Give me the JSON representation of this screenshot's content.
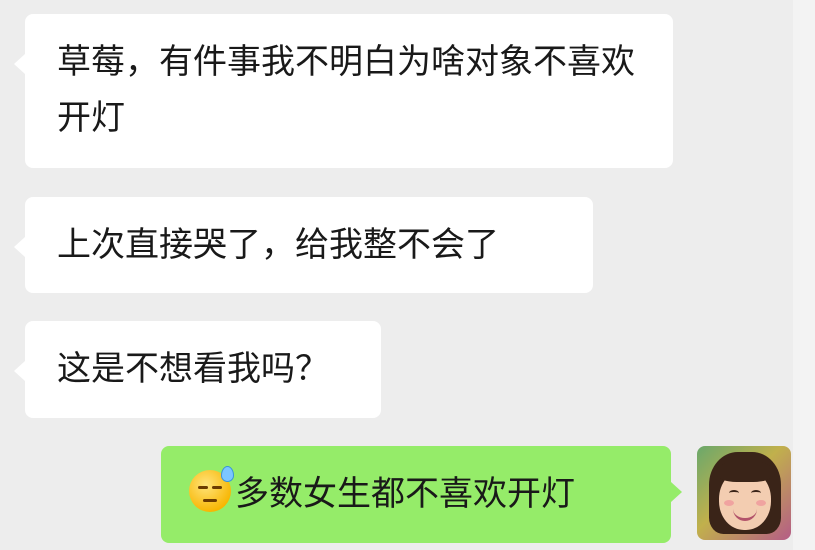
{
  "messages": [
    {
      "direction": "incoming",
      "text": "草莓，有件事我不明白为啥对象不喜欢开灯"
    },
    {
      "direction": "incoming",
      "text": "上次直接哭了，给我整不会了"
    },
    {
      "direction": "incoming",
      "text": "这是不想看我吗？"
    },
    {
      "direction": "outgoing",
      "emoji": "downcast-face-with-sweat-icon",
      "text": "多数女生都不喜欢开灯"
    }
  ],
  "colors": {
    "background": "#ededed",
    "incoming_bubble": "#ffffff",
    "outgoing_bubble": "#95ec69",
    "text": "#191919"
  }
}
